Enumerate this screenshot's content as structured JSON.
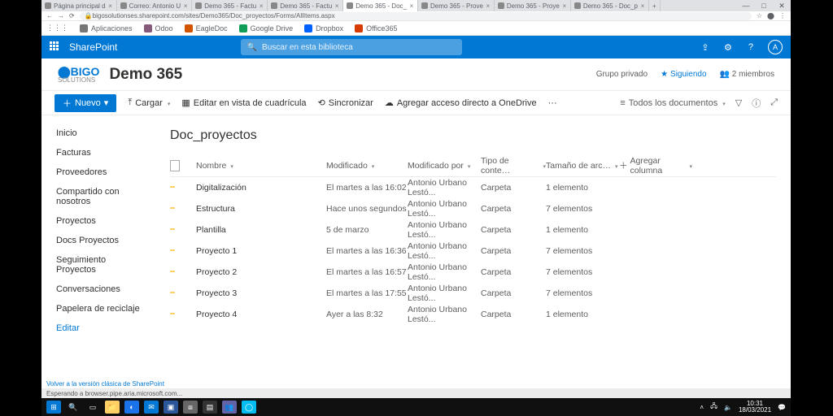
{
  "browser": {
    "tabs": [
      {
        "label": "Página principal d"
      },
      {
        "label": "Correo: Antonio U"
      },
      {
        "label": "Demo 365 - Factu"
      },
      {
        "label": "Demo 365 - Factu"
      },
      {
        "label": "Demo 365 - Doc_"
      },
      {
        "label": "Demo 365 - Prove"
      },
      {
        "label": "Demo 365 - Proye"
      },
      {
        "label": "Demo 365 - Doc_p"
      }
    ],
    "url": "bigosolutionses.sharepoint.com/sites/Demo365/Doc_proyectos/Forms/AllItems.aspx",
    "bookmarks": [
      {
        "label": "Aplicaciones",
        "color": "#777"
      },
      {
        "label": "Odoo",
        "color": "#875A7B"
      },
      {
        "label": "EagleDoc",
        "color": "#d35400"
      },
      {
        "label": "Google Drive",
        "color": "#0f9d58"
      },
      {
        "label": "Dropbox",
        "color": "#0061ff"
      },
      {
        "label": "Office365",
        "color": "#d83b01"
      }
    ]
  },
  "suite": {
    "product": "SharePoint",
    "search_placeholder": "Buscar en esta biblioteca",
    "avatar_initial": "A"
  },
  "site": {
    "logo_top": "BIGO",
    "logo_bottom": "SOLUTIONS",
    "title": "Demo 365",
    "privacy": "Grupo privado",
    "following": "Siguiendo",
    "members": "2 miembros"
  },
  "commands": {
    "new": "Nuevo",
    "upload": "Cargar",
    "edit_grid": "Editar en vista de cuadrícula",
    "sync": "Sincronizar",
    "add_onedrive": "Agregar acceso directo a OneDrive",
    "view": "Todos los documentos"
  },
  "nav": {
    "items": [
      "Inicio",
      "Facturas",
      "Proveedores",
      "Compartido con nosotros",
      "Proyectos",
      "Docs Proyectos",
      "Seguimiento Proyectos",
      "Conversaciones",
      "Papelera de reciclaje"
    ],
    "edit": "Editar",
    "active_index": 5,
    "classic_link": "Volver a la versión clásica de SharePoint"
  },
  "library": {
    "title": "Doc_proyectos",
    "columns": {
      "name": "Nombre",
      "modified": "Modificado",
      "modified_by": "Modificado por",
      "content_type": "Tipo de conte…",
      "size": "Tamaño de arc…",
      "add": "Agregar columna"
    },
    "rows": [
      {
        "name": "Digitalización",
        "modified": "El martes a las 16:02",
        "by": "Antonio Urbano Lestó...",
        "type": "Carpeta",
        "size": "1 elemento"
      },
      {
        "name": "Estructura",
        "modified": "Hace unos segundos",
        "by": "Antonio Urbano Lestó...",
        "type": "Carpeta",
        "size": "7 elementos"
      },
      {
        "name": "Plantilla",
        "modified": "5 de marzo",
        "by": "Antonio Urbano Lestó...",
        "type": "Carpeta",
        "size": "1 elemento"
      },
      {
        "name": "Proyecto 1",
        "modified": "El martes a las 16:36",
        "by": "Antonio Urbano Lestó...",
        "type": "Carpeta",
        "size": "7 elementos"
      },
      {
        "name": "Proyecto 2",
        "modified": "El martes a las 16:57",
        "by": "Antonio Urbano Lestó...",
        "type": "Carpeta",
        "size": "7 elementos"
      },
      {
        "name": "Proyecto 3",
        "modified": "El martes a las 17:55",
        "by": "Antonio Urbano Lestó...",
        "type": "Carpeta",
        "size": "7 elementos"
      },
      {
        "name": "Proyecto 4",
        "modified": "Ayer a las 8:32",
        "by": "Antonio Urbano Lestó...",
        "type": "Carpeta",
        "size": "1 elemento"
      }
    ]
  },
  "status_text": "Esperando a browser.pipe.aria.microsoft.com...",
  "taskbar": {
    "time": "10:31",
    "date": "18/03/2021"
  }
}
